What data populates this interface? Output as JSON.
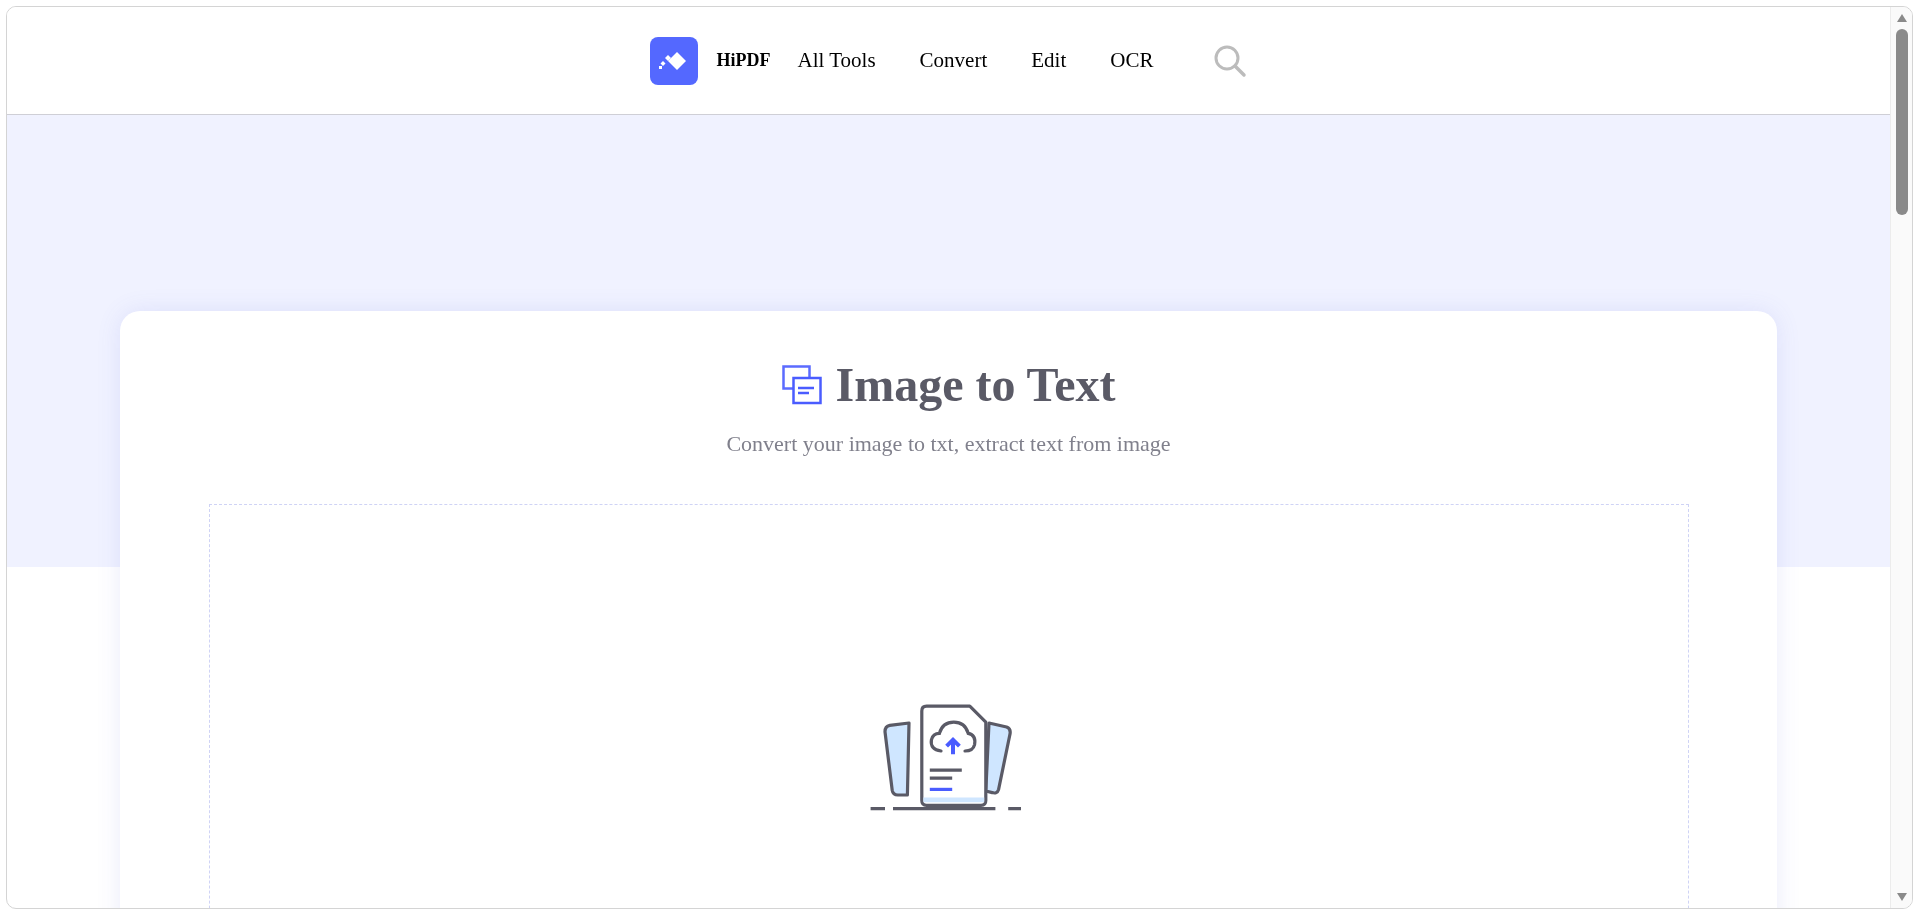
{
  "header": {
    "brand": "HiPDF",
    "nav": [
      "All Tools",
      "Convert",
      "Edit",
      "OCR"
    ]
  },
  "tool": {
    "title": "Image to Text",
    "subtitle": "Convert your image to txt, extract text from image"
  }
}
